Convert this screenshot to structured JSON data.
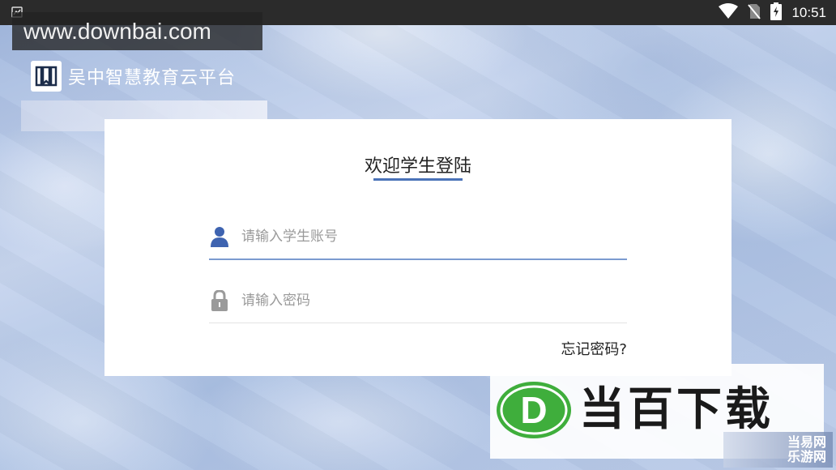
{
  "status_bar": {
    "time": "10:51",
    "icons": [
      "notification-icon",
      "wifi-icon",
      "no-sim-icon",
      "battery-charging-icon"
    ]
  },
  "watermark_top": {
    "text": "www.downbai.com"
  },
  "brand": {
    "name": "吴中智慧教育云平台",
    "logo_icon": "book-icon"
  },
  "login": {
    "title": "欢迎学生登陆",
    "username": {
      "placeholder": "请输入学生账号",
      "value": "",
      "icon": "user-icon"
    },
    "password": {
      "placeholder": "请输入密码",
      "value": "",
      "icon": "lock-icon"
    },
    "forgot_label": "忘记密码?"
  },
  "watermark_bottom": {
    "text": "当百下载",
    "logo_letter": "D",
    "corner_text": "当易网\n乐游网"
  },
  "colors": {
    "accent": "#4a72b8",
    "field_active": "#7b9bd0",
    "logo_green": "#3fae3c"
  }
}
